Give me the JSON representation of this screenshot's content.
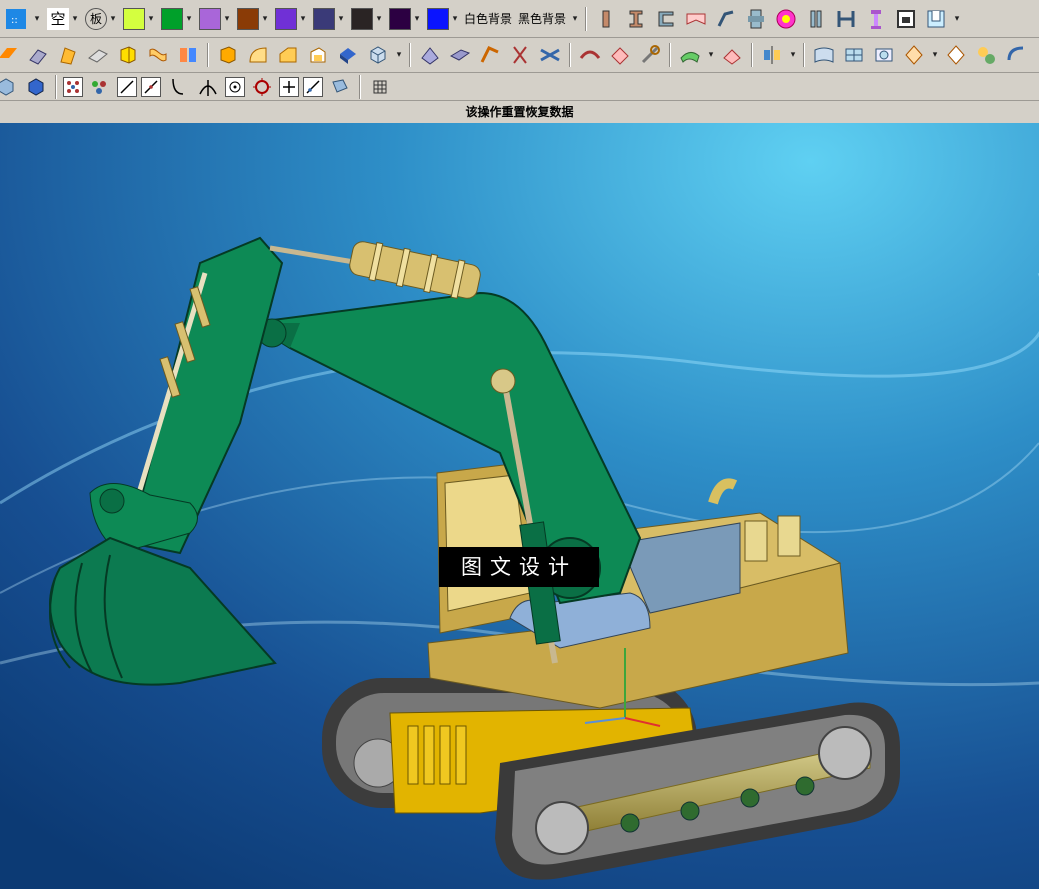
{
  "toolbar1": {
    "glyph_kong": "空",
    "glyph_ban": "板",
    "colors": [
      "#d4ff3f",
      "#00a02a",
      "#a966d9",
      "#8a3b06",
      "#7030d6",
      "#3a3a78",
      "#2a2424",
      "#2c0042",
      "#0a14ff"
    ],
    "white_bg_label": "白色背景",
    "black_bg_label": "黑色背景"
  },
  "status": {
    "message": "该操作重置恢复数据"
  },
  "watermark": {
    "text": "图文设计"
  },
  "viewport": {
    "bg_top": "#4fc2e8",
    "bg_bottom": "#0c3a74",
    "boom_color": "#0d8a55",
    "body_color": "#c8a84a",
    "track_color": "#3c3c3c"
  }
}
